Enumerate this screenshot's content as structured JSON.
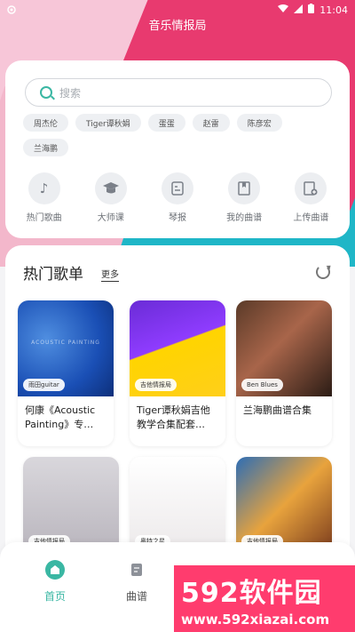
{
  "status_bar": {
    "time": "11:04"
  },
  "app": {
    "title": "音乐情报局"
  },
  "search": {
    "placeholder": "搜索"
  },
  "tags": [
    "周杰伦",
    "Tiger谭秋娟",
    "蛋蛋",
    "赵雷",
    "陈彦宏",
    "兰海鹏"
  ],
  "quick_menu": [
    {
      "label": "热门歌曲",
      "icon": "music-disc-icon"
    },
    {
      "label": "大师课",
      "icon": "graduation-cap-icon"
    },
    {
      "label": "琴报",
      "icon": "news-icon"
    },
    {
      "label": "我的曲谱",
      "icon": "book-icon"
    },
    {
      "label": "上传曲谱",
      "icon": "upload-sheet-icon"
    }
  ],
  "hot_section": {
    "title": "热门歌单",
    "more": "更多"
  },
  "playlists": [
    {
      "badge": "雨田guitar",
      "title": "何康《Acoustic Painting》专…",
      "cover_text": "ACOUSTIC PAINTING"
    },
    {
      "badge": "吉他情报局",
      "title": "Tiger谭秋娟吉他教学合集配套…"
    },
    {
      "badge": "Ben Blues",
      "title": "兰海鹏曲谱合集"
    },
    {
      "badge": "吉他情报局",
      "title": ""
    },
    {
      "badge": "奥特之星",
      "title": ""
    },
    {
      "badge": "吉他情报局",
      "title": ""
    }
  ],
  "bottom_nav": [
    {
      "label": "首页",
      "icon": "home-icon"
    },
    {
      "label": "曲谱",
      "icon": "sheet-icon"
    }
  ],
  "watermark": {
    "line1": "592软件园",
    "line2": "www.592xiazai.com"
  },
  "colors": {
    "accent": "#3ab7a3",
    "pink": "#e83a6f",
    "teal": "#1fb6c7"
  }
}
